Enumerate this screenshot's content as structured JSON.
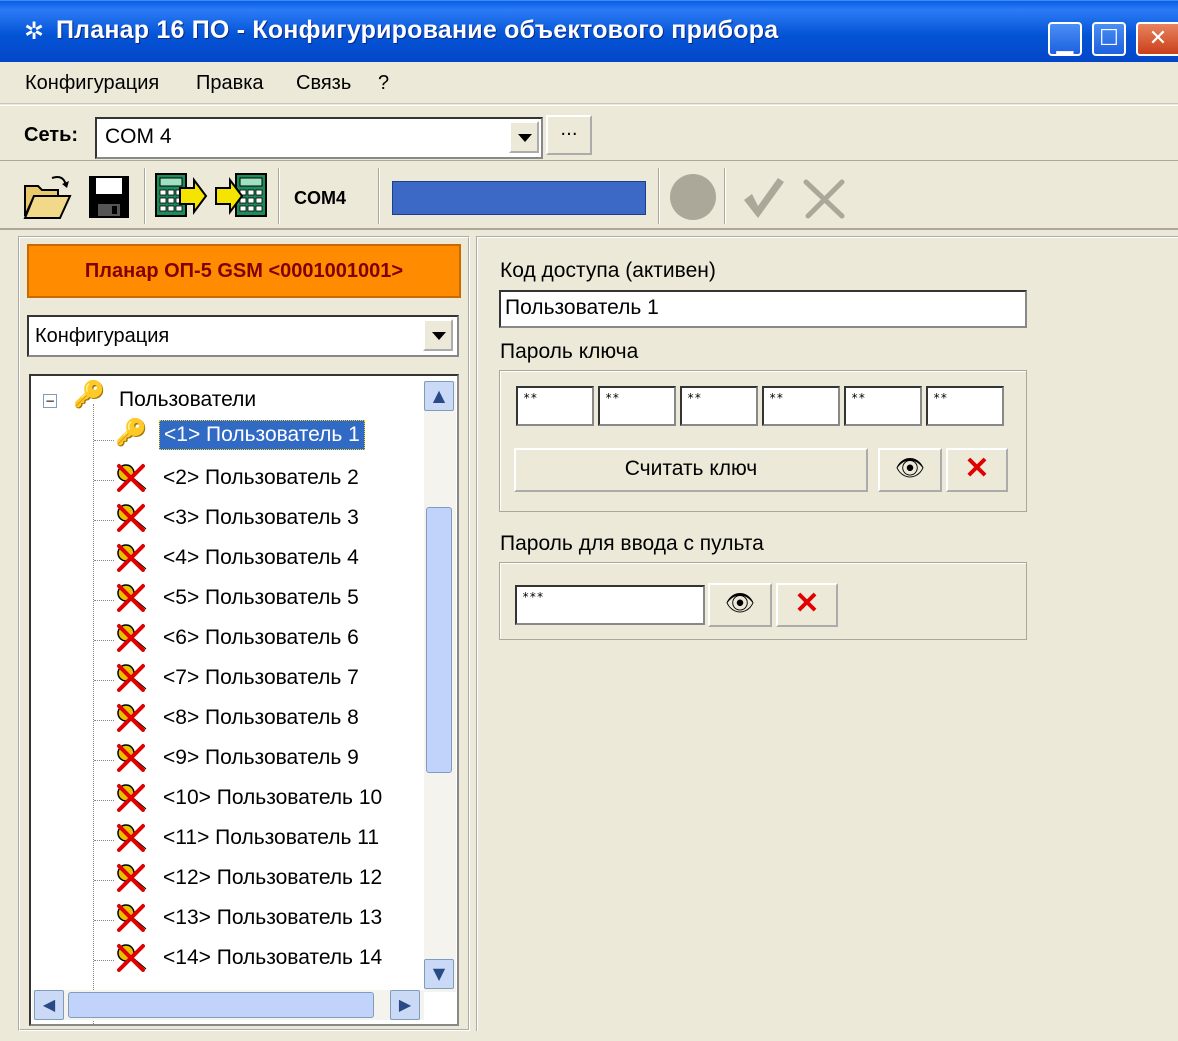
{
  "window": {
    "title": "Планар 16 ПО - Конфигурирование объектового прибора",
    "icon": "gear-icon",
    "controls": [
      "minimize-icon",
      "maximize-icon",
      "close-icon"
    ]
  },
  "menu": {
    "items": [
      "Конфигурация",
      "Правка",
      "Связь",
      "?"
    ]
  },
  "network": {
    "label": "Сеть:",
    "value": "COM 4",
    "more_label": "..."
  },
  "toolbar": {
    "buttons": [
      "open-folder-icon",
      "save-icon",
      "read-device-icon",
      "write-device-icon"
    ],
    "port_label": "COM4",
    "progress": 1.0,
    "colors": {
      "progress": "#3C68C6",
      "status": "#ACA899"
    }
  },
  "device": {
    "name": "Планар ОП-5 GSM <0001001001>",
    "color": "#FF8C00"
  },
  "view_select": {
    "value": "Конфигурация"
  },
  "tree": {
    "root": "Пользователи",
    "selected": "<1> Пользователь 1",
    "items": [
      "<2> Пользователь 2",
      "<3> Пользователь 3",
      "<4> Пользователь 4",
      "<5> Пользователь 5",
      "<6> Пользователь 6",
      "<7> Пользователь 7",
      "<8> Пользователь 8",
      "<9> Пользователь 9",
      "<10> Пользователь 10",
      "<11> Пользователь 11",
      "<12> Пользователь 12",
      "<13> Пользователь 13",
      "<14> Пользователь 14"
    ]
  },
  "access": {
    "code_label": "Код доступа (активен)",
    "code_value": "Пользователь 1",
    "key_password_label": "Пароль ключа",
    "key_bytes": [
      "**",
      "**",
      "**",
      "**",
      "**",
      "**"
    ],
    "read_key_label": "Считать ключ",
    "console_password_label": "Пароль для ввода с пульта",
    "console_password_value": "***"
  }
}
